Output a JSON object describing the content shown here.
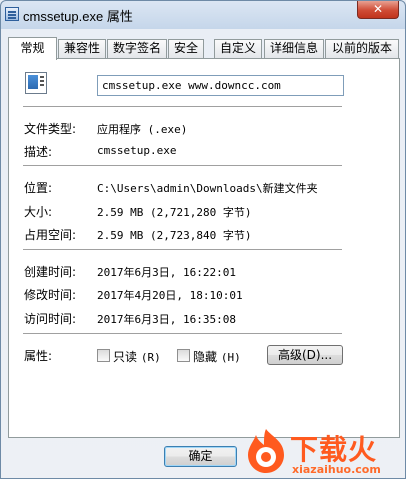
{
  "window": {
    "title": "cmssetup.exe 属性",
    "close_label": "✕"
  },
  "tabs": [
    {
      "label": "常规",
      "active": true
    },
    {
      "label": "兼容性",
      "active": false
    },
    {
      "label": "数字签名",
      "active": false
    },
    {
      "label": "安全",
      "active": false
    },
    {
      "label": "自定义",
      "active": false
    },
    {
      "label": "详细信息",
      "active": false
    },
    {
      "label": "以前的版本",
      "active": false
    }
  ],
  "general": {
    "file_name": "cmssetup.exe  www.downcc.com",
    "type_label": "文件类型:",
    "type_value": "应用程序 (.exe)",
    "desc_label": "描述:",
    "desc_value": "cmssetup.exe",
    "location_label": "位置:",
    "location_value": "C:\\Users\\admin\\Downloads\\新建文件夹",
    "size_label": "大小:",
    "size_value": "2.59 MB (2,721,280 字节)",
    "disk_label": "占用空间:",
    "disk_value": "2.59 MB (2,723,840 字节)",
    "created_label": "创建时间:",
    "created_value": "2017年6月3日, 16:22:01",
    "modified_label": "修改时间:",
    "modified_value": "2017年4月20日, 18:10:01",
    "accessed_label": "访问时间:",
    "accessed_value": "2017年6月3日, 16:35:08",
    "attr_label": "属性:",
    "readonly_label": "只读",
    "readonly_key": "(R)",
    "readonly_checked": false,
    "hidden_label": "隐藏",
    "hidden_key": "(H)",
    "hidden_checked": false,
    "advanced_label": "高级(D)..."
  },
  "footer": {
    "ok_label": "确定"
  },
  "watermark": {
    "text": "下载火",
    "url": "xiazaihuo.com",
    "color": "#ff5a1f"
  }
}
